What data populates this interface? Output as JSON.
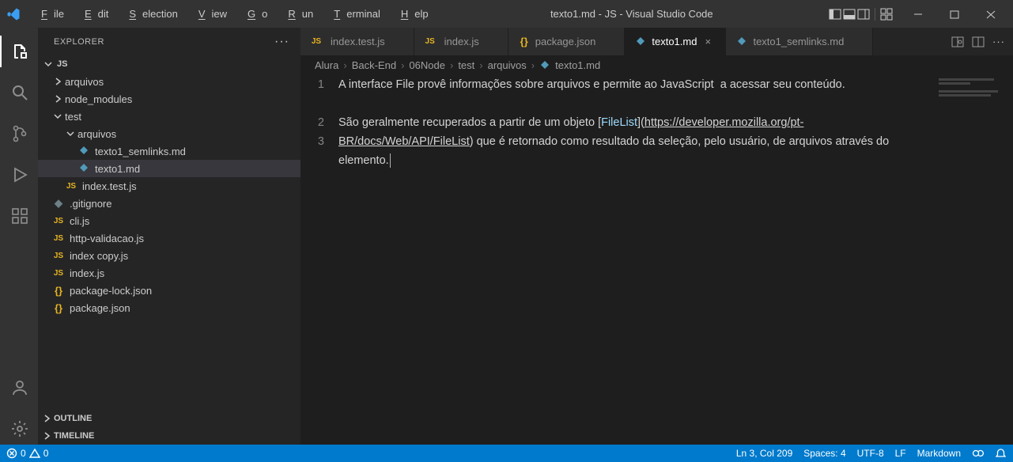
{
  "window": {
    "title": "texto1.md - JS - Visual Studio Code"
  },
  "menu": {
    "file": "File",
    "edit": "Edit",
    "selection": "Selection",
    "view": "View",
    "go": "Go",
    "run": "Run",
    "terminal": "Terminal",
    "help": "Help"
  },
  "sidebar": {
    "title": "EXPLORER",
    "workspace": "JS",
    "tree": [
      {
        "label": "arquivos",
        "type": "folder",
        "expanded": false,
        "indent": 1
      },
      {
        "label": "node_modules",
        "type": "folder",
        "expanded": false,
        "indent": 1
      },
      {
        "label": "test",
        "type": "folder",
        "expanded": true,
        "indent": 1
      },
      {
        "label": "arquivos",
        "type": "folder",
        "expanded": true,
        "indent": 2
      },
      {
        "label": "texto1_semlinks.md",
        "type": "md",
        "indent": 3
      },
      {
        "label": "texto1.md",
        "type": "md",
        "indent": 3,
        "selected": true
      },
      {
        "label": "index.test.js",
        "type": "js",
        "indent": 2
      },
      {
        "label": ".gitignore",
        "type": "gitignore",
        "indent": 1
      },
      {
        "label": "cli.js",
        "type": "js",
        "indent": 1
      },
      {
        "label": "http-validacao.js",
        "type": "js",
        "indent": 1
      },
      {
        "label": "index copy.js",
        "type": "js",
        "indent": 1
      },
      {
        "label": "index.js",
        "type": "js",
        "indent": 1
      },
      {
        "label": "package-lock.json",
        "type": "json",
        "indent": 1
      },
      {
        "label": "package.json",
        "type": "json",
        "indent": 1
      }
    ],
    "outline": "OUTLINE",
    "timeline": "TIMELINE"
  },
  "tabs": [
    {
      "label": "index.test.js",
      "icon": "js"
    },
    {
      "label": "index.js",
      "icon": "js"
    },
    {
      "label": "package.json",
      "icon": "json"
    },
    {
      "label": "texto1.md",
      "icon": "md",
      "active": true
    },
    {
      "label": "texto1_semlinks.md",
      "icon": "md"
    }
  ],
  "breadcrumbs": [
    "Alura",
    "Back-End",
    "06Node",
    "test",
    "arquivos",
    "texto1.md"
  ],
  "editor": {
    "lines": [
      "1",
      "2",
      "3"
    ],
    "line1": "A interface File provê informações sobre arquivos e permite ao JavaScript  a acessar seu conteúdo.",
    "line3_pre": "São geralmente recuperados a partir de um objeto ",
    "link_name": "FileList",
    "link_url": "https://developer.mozilla.org/pt-BR/docs/Web/API/FileList",
    "line3_post": " que é retornado como resultado da seleção, pelo usuário, de arquivos através do elemento."
  },
  "status": {
    "errors": "0",
    "warnings": "0",
    "pos": "Ln 3, Col 209",
    "spaces": "Spaces: 4",
    "encoding": "UTF-8",
    "eol": "LF",
    "lang": "Markdown"
  }
}
